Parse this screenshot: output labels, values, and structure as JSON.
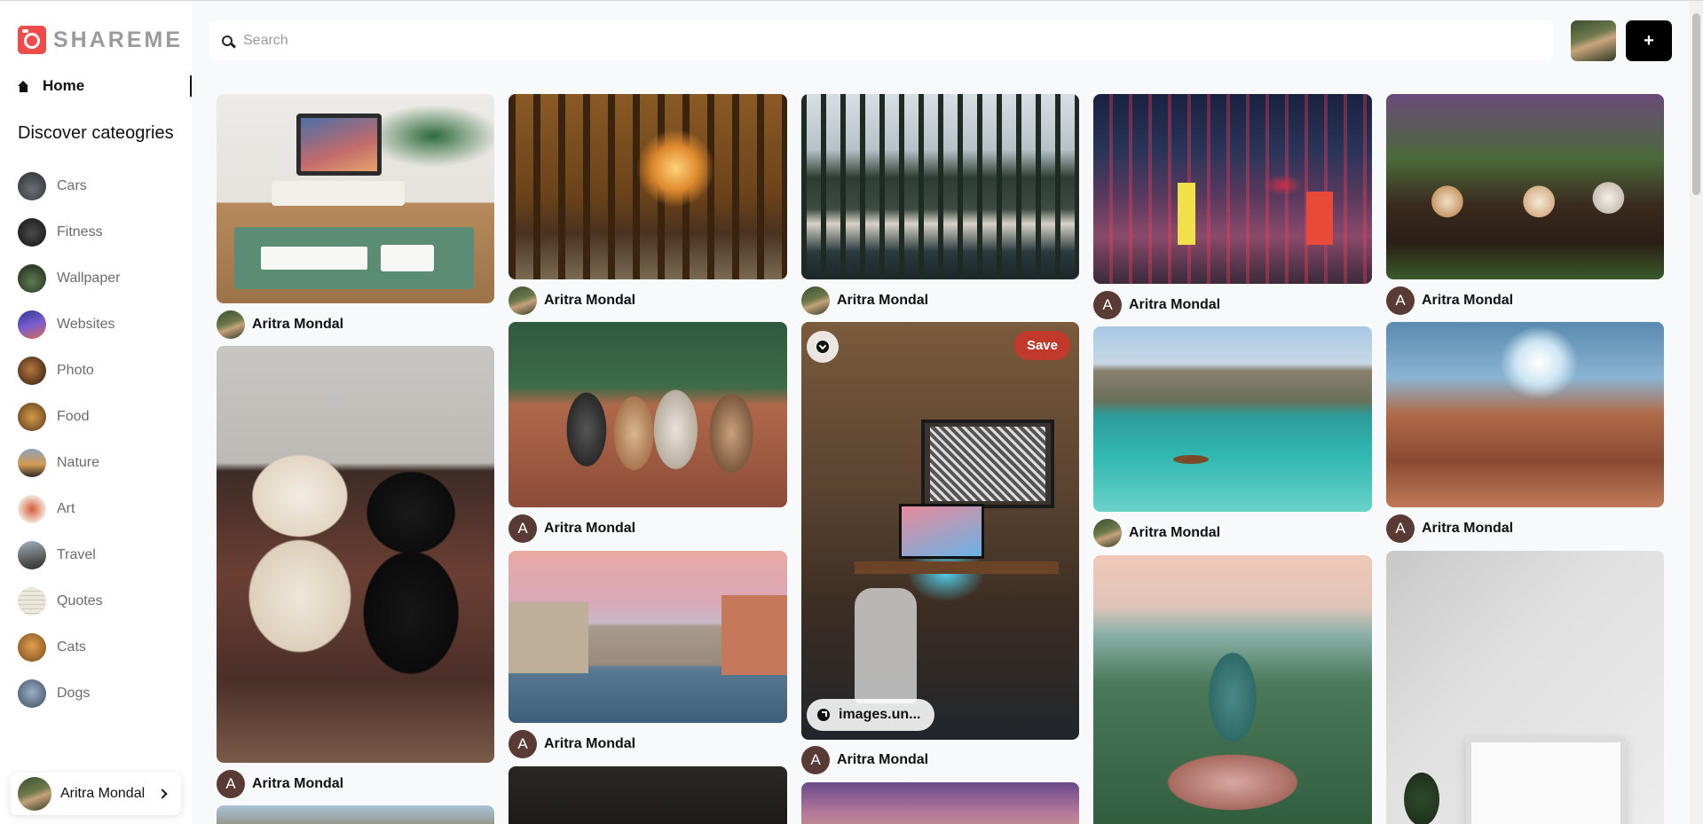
{
  "app": {
    "logo_text": "SHAREME"
  },
  "sidebar": {
    "home_label": "Home",
    "categories_heading": "Discover cateogries",
    "categories": [
      {
        "label": "Cars"
      },
      {
        "label": "Fitness"
      },
      {
        "label": "Wallpaper"
      },
      {
        "label": "Websites"
      },
      {
        "label": "Photo"
      },
      {
        "label": "Food"
      },
      {
        "label": "Nature"
      },
      {
        "label": "Art"
      },
      {
        "label": "Travel"
      },
      {
        "label": "Quotes"
      },
      {
        "label": "Cats"
      },
      {
        "label": "Dogs"
      }
    ],
    "profile": {
      "name": "Aritra Mondal"
    }
  },
  "search": {
    "placeholder": "Search",
    "value": ""
  },
  "header": {
    "add_label": "+"
  },
  "pins": [
    {
      "author": "Aritra Mondal",
      "avatar_type": "photo",
      "image": "desk setup with laptop"
    },
    {
      "author": "Aritra Mondal",
      "avatar_type": "photo",
      "image": "forest sunset path"
    },
    {
      "author": "Aritra Mondal",
      "avatar_type": "photo",
      "image": "misty lake forest"
    },
    {
      "author": "Aritra Mondal",
      "avatar_type": "letter",
      "avatar_letter": "A",
      "image": "neon city street"
    },
    {
      "author": "Aritra Mondal",
      "avatar_type": "letter",
      "avatar_letter": "A",
      "image": "kittens in basket"
    },
    {
      "author": "Aritra Mondal",
      "avatar_type": "letter",
      "avatar_letter": "A",
      "image": "two dogs on rug"
    },
    {
      "author": "Aritra Mondal",
      "avatar_type": "letter",
      "avatar_letter": "A",
      "image": "dogs on leash"
    },
    {
      "author": "Aritra Mondal",
      "avatar_type": "letter",
      "avatar_letter": "A",
      "image": "gaming room setup",
      "save_label": "Save",
      "source_label": "images.un..."
    },
    {
      "author": "Aritra Mondal",
      "avatar_type": "photo",
      "image": "mountain lake canoe"
    },
    {
      "author": "Aritra Mondal",
      "avatar_type": "letter",
      "avatar_letter": "A",
      "image": "canyon sunburst"
    },
    {
      "author": "Aritra Mondal",
      "avatar_type": "letter",
      "avatar_letter": "A",
      "image": "venice canal"
    },
    {
      "author": "",
      "image": "buddha statue"
    },
    {
      "author": "",
      "image": "white wall frame"
    },
    {
      "author": "",
      "image": "mountain cliff"
    },
    {
      "author": "",
      "image": "dark room"
    },
    {
      "author": "",
      "image": "purple sky street"
    }
  ],
  "colors": {
    "accent": "#ef4b4b",
    "save": "#c0392b",
    "add_button": "#000000"
  }
}
